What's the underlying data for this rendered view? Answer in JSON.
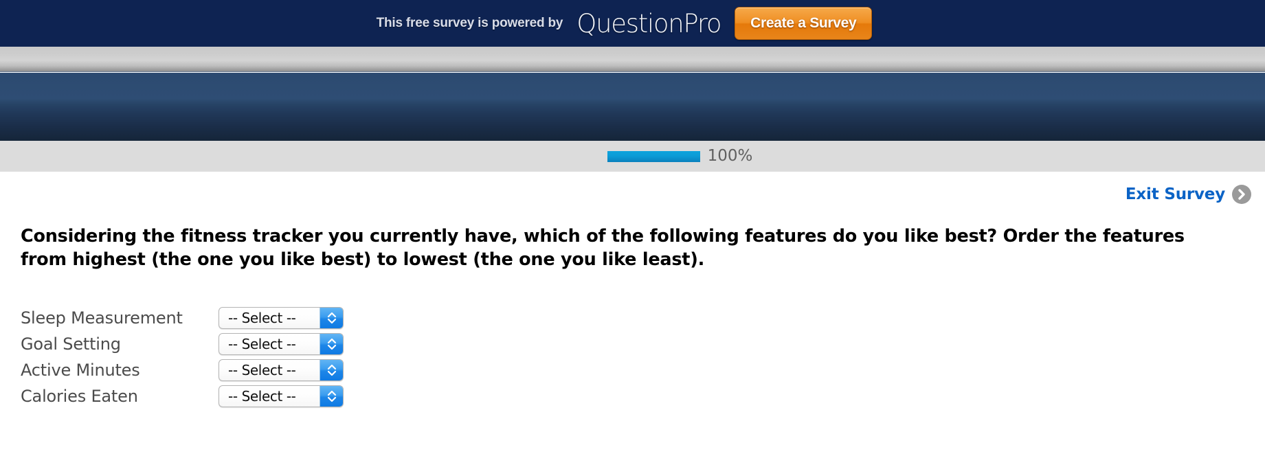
{
  "promo": {
    "text": "This free survey is powered by",
    "logo": "QuestionPro",
    "cta_label": "Create a Survey"
  },
  "progress": {
    "percent_label": "100%",
    "percent_value": 100,
    "fill_color": "#0b9bd6",
    "track_color": "#dcdcdc"
  },
  "exit": {
    "label": "Exit Survey",
    "icon": "circle-arrow-right-icon"
  },
  "question": {
    "text": "Considering the fitness tracker you currently have, which of the following features do you like best? Order the features from highest (the one you like best) to lowest (the one you like least)."
  },
  "rank_rows": [
    {
      "label": "Sleep Measurement",
      "value": "-- Select --"
    },
    {
      "label": "Goal Setting",
      "value": "-- Select --"
    },
    {
      "label": "Active Minutes",
      "value": "-- Select --"
    },
    {
      "label": "Calories Eaten",
      "value": "-- Select --"
    }
  ],
  "colors": {
    "promo_bar": "#0e2352",
    "cta_orange": "#ef8e22",
    "header_blue": "#2c4a70",
    "link_blue": "#0b63c6"
  }
}
